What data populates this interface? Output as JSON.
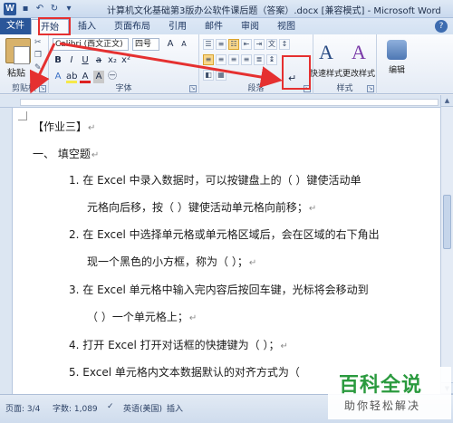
{
  "window": {
    "title": "计算机文化基础第3版办公软件课后题（答案）.docx [兼容模式] - Microsoft Word",
    "app_icon": "W"
  },
  "tabs": {
    "file": "文件",
    "items": [
      "开始",
      "插入",
      "页面布局",
      "引用",
      "邮件",
      "审阅",
      "视图"
    ]
  },
  "ribbon": {
    "clipboard": {
      "paste": "粘贴",
      "label": "剪贴板"
    },
    "font": {
      "name": "Calibri (西文正文)",
      "size": "四号",
      "label": "字体"
    },
    "paragraph": {
      "label": "段落"
    },
    "styles": {
      "quick": "快速样式",
      "change": "更改样式",
      "label": "样式"
    },
    "editing": {
      "label": "编辑"
    }
  },
  "document": {
    "heading": "【作业三】",
    "section": "一、   填空题",
    "lines": [
      "1.  在 Excel 中录入数据时，可以按键盘上的（        ）键使活动单",
      "元格向后移，按（          ）键使活动单元格向前移；",
      "2.  在 Excel 中选择单元格或单元格区域后，会在区域的右下角出",
      "现一个黑色的小方框，称为（          ）；",
      "3.  在 Excel 单元格中输入完内容后按回车键，光标将会移动到",
      "（          ）一个单元格上；",
      "4.  打开 Excel 打开对话框的快捷键为（                    ）；",
      "5.  Excel 单元格内文本数据默认的对齐方式为（"
    ]
  },
  "statusbar": {
    "page": "页面: 3/4",
    "words": "字数: 1,089",
    "language": "英语(美国)",
    "mode": "插入"
  },
  "watermark": {
    "title": "百科全说",
    "subtitle": "助你轻松解决"
  },
  "colors": {
    "accent": "#2a5699",
    "annotation": "#e53030",
    "watermark_green": "#2a9a3e"
  }
}
